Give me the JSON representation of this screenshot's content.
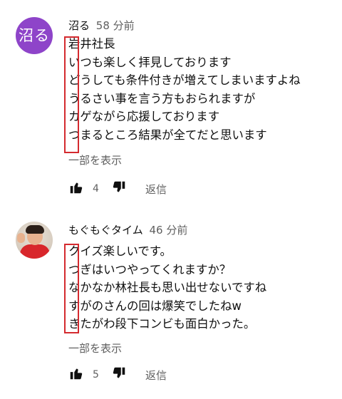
{
  "comments": [
    {
      "avatar_text": "沼る",
      "avatar_color": "#8e44c9",
      "author": "沼る",
      "time": "58 分前",
      "lines": [
        "岩井社長",
        "いつも楽しく拝見しております",
        "どうしても条件付きが増えてしまいますよね",
        "うるさい事を言う方もおられますが",
        "カゲながら応援しております",
        "つまるところ結果が全てだと思います"
      ],
      "show_more": "一部を表示",
      "like_count": "4",
      "reply_label": "返信"
    },
    {
      "author": "もぐもぐタイム",
      "time": "46 分前",
      "lines": [
        "クイズ楽しいです。",
        "つぎはいつやってくれますか？",
        "なかなか林社長も思い出せないですね",
        "すがのさんの回は爆笑でしたねw",
        "きたがわ段下コンビも面白かった。"
      ],
      "show_more": "一部を表示",
      "like_count": "5",
      "reply_label": "返信"
    }
  ],
  "highlight_color": "#d42a2f",
  "icons": [
    "thumbs-up-icon",
    "thumbs-down-icon"
  ]
}
